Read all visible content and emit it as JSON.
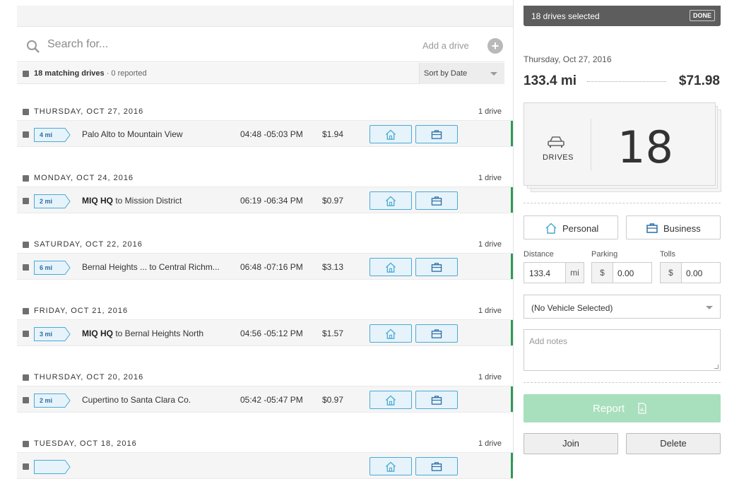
{
  "search": {
    "placeholder": "Search for...",
    "add_label": "Add a drive",
    "plus": "+"
  },
  "filter": {
    "matching": "18 matching drives",
    "reported": " · 0 reported",
    "sort": "Sort by Date"
  },
  "days": [
    {
      "date": "THURSDAY, OCT 27, 2016",
      "count": "1 drive",
      "distance": "4 mi",
      "from": "Palo Alto",
      "from_bold": false,
      "to": "to Mountain View",
      "time": "04:48 -05:03 PM",
      "amount": "$1.94"
    },
    {
      "date": "MONDAY, OCT 24, 2016",
      "count": "1 drive",
      "distance": "2 mi",
      "from": "MIQ HQ",
      "from_bold": true,
      "to": "to Mission District",
      "time": "06:19 -06:34 PM",
      "amount": "$0.97"
    },
    {
      "date": "SATURDAY, OCT 22, 2016",
      "count": "1 drive",
      "distance": "6 mi",
      "from": "Bernal Heights ...",
      "from_bold": false,
      "to": " to Central Richm...",
      "time": "06:48 -07:16 PM",
      "amount": "$3.13"
    },
    {
      "date": "FRIDAY, OCT 21, 2016",
      "count": "1 drive",
      "distance": "3 mi",
      "from": "MIQ HQ",
      "from_bold": true,
      "to": "to Bernal Heights North",
      "time": "04:56 -05:12 PM",
      "amount": "$1.57"
    },
    {
      "date": "THURSDAY, OCT 20, 2016",
      "count": "1 drive",
      "distance": "2 mi",
      "from": "Cupertino",
      "from_bold": false,
      "to": "to Santa Clara Co.",
      "time": "05:42 -05:47 PM",
      "amount": "$0.97"
    },
    {
      "date": "TUESDAY, OCT 18, 2016",
      "count": "1 drive",
      "distance": "",
      "from": "",
      "from_bold": false,
      "to": "",
      "time": "",
      "amount": ""
    }
  ],
  "panel": {
    "selected": "18 drives selected",
    "done": "DONE",
    "date": "Thursday, Oct 27, 2016",
    "miles": "133.4 mi",
    "money": "$71.98",
    "drives_label": "DRIVES",
    "drives_count": "18",
    "personal": "Personal",
    "business": "Business",
    "distance_label": "Distance",
    "distance_value": "133.4",
    "distance_unit": "mi",
    "parking_label": "Parking",
    "parking_value": "0.00",
    "tolls_label": "Tolls",
    "tolls_value": "0.00",
    "currency": "$",
    "vehicle": "(No Vehicle Selected)",
    "notes_placeholder": "Add notes",
    "report": "Report",
    "join": "Join",
    "delete": "Delete"
  },
  "colors": {
    "accent_green": "#2e9a57",
    "button_blue": "#4aaad6",
    "report_green": "#a8dfbc"
  }
}
